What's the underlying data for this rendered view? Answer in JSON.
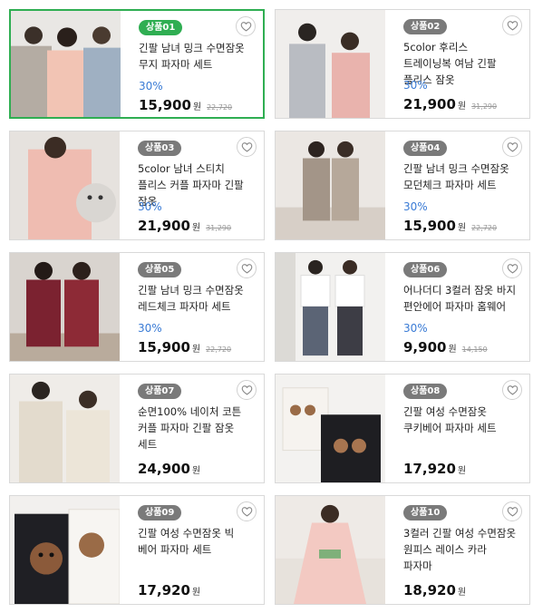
{
  "currency": "원",
  "products": [
    {
      "badge": "상품01",
      "title": "긴팔 남녀 밍크 수면잠옷 무지 파자마 세트",
      "discount": "30%",
      "price": "15,900",
      "original": "22,720",
      "selected": true
    },
    {
      "badge": "상품02",
      "title": "5color 후리스 트레이닝복 여남 긴팔 플리스 잠옷",
      "discount": "30%",
      "price": "21,900",
      "original": "31,290",
      "selected": false
    },
    {
      "badge": "상품03",
      "title": "5color 남녀 스티치 플리스 커플 파자마 긴팔 잠옷",
      "discount": "30%",
      "price": "21,900",
      "original": "31,290",
      "selected": false
    },
    {
      "badge": "상품04",
      "title": "긴팔 남녀 밍크 수면잠옷 모던체크 파자마 세트",
      "discount": "30%",
      "price": "15,900",
      "original": "22,720",
      "selected": false
    },
    {
      "badge": "상품05",
      "title": "긴팔 남녀 밍크 수면잠옷 레드체크 파자마 세트",
      "discount": "30%",
      "price": "15,900",
      "original": "22,720",
      "selected": false
    },
    {
      "badge": "상품06",
      "title": "어나더디 3컬러 잠옷 바지 편안에어 파자마 홈웨어",
      "discount": "30%",
      "price": "9,900",
      "original": "14,150",
      "selected": false
    },
    {
      "badge": "상품07",
      "title": "순면100% 네이처 코튼 커플 파자마 긴팔 잠옷 세트",
      "discount": "",
      "price": "24,900",
      "original": "",
      "selected": false
    },
    {
      "badge": "상품08",
      "title": "긴팔 여성 수면잠옷 쿠키베어 파자마 세트",
      "discount": "",
      "price": "17,920",
      "original": "",
      "selected": false
    },
    {
      "badge": "상품09",
      "title": "긴팔 여성 수면잠옷 빅 베어 파자마 세트",
      "discount": "",
      "price": "17,920",
      "original": "",
      "selected": false
    },
    {
      "badge": "상품10",
      "title": "3컬러 긴팔 여성 수면잠옷 원피스 레이스 카라 파자마",
      "discount": "",
      "price": "18,920",
      "original": "",
      "selected": false
    }
  ],
  "icons": {
    "wishlist": "heart-outline-icon"
  },
  "colors": {
    "selected_border": "#2fae52",
    "discount": "#3a7bd5",
    "badge": "#7a7a7a"
  }
}
